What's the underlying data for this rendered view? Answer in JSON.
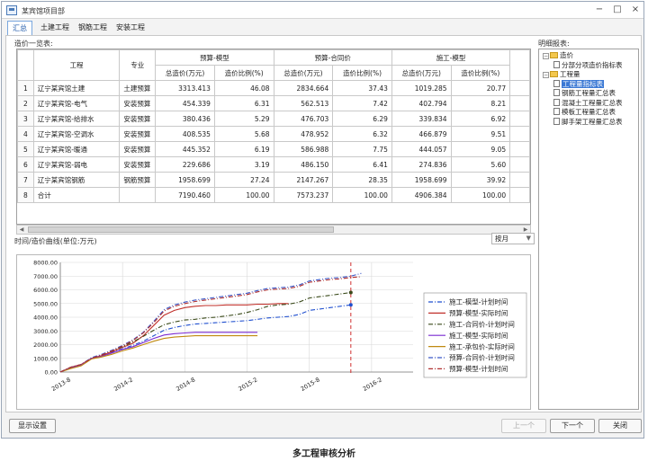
{
  "window": {
    "title": "某宾馆项目部"
  },
  "tabs": [
    {
      "label": "汇总",
      "active": true
    },
    {
      "label": "土建工程",
      "active": false
    },
    {
      "label": "钢筋工程",
      "active": false
    },
    {
      "label": "安装工程",
      "active": false
    }
  ],
  "price_list": {
    "label": "造价一览表:",
    "columns": {
      "project": "工程",
      "discipline": "专业",
      "groups": [
        "预算-模型",
        "预算-合同价",
        "施工-模型"
      ],
      "total": "总造价(万元)",
      "ratio": "造价比例(%)"
    },
    "rows": [
      {
        "no": "1",
        "name": "辽宁某宾馆土建",
        "type": "土建预算",
        "v": [
          "3313.413",
          "46.08",
          "2834.664",
          "37.43",
          "1019.285",
          "20.77"
        ]
      },
      {
        "no": "2",
        "name": "辽宁某宾馆-电气",
        "type": "安装预算",
        "v": [
          "454.339",
          "6.31",
          "562.513",
          "7.42",
          "402.794",
          "8.21"
        ]
      },
      {
        "no": "3",
        "name": "辽宁某宾馆-给排水",
        "type": "安装预算",
        "v": [
          "380.436",
          "5.29",
          "476.703",
          "6.29",
          "339.834",
          "6.92"
        ]
      },
      {
        "no": "4",
        "name": "辽宁某宾馆-空调水",
        "type": "安装预算",
        "v": [
          "408.535",
          "5.68",
          "478.952",
          "6.32",
          "466.879",
          "9.51"
        ]
      },
      {
        "no": "5",
        "name": "辽宁某宾馆-暖通",
        "type": "安装预算",
        "v": [
          "445.352",
          "6.19",
          "586.988",
          "7.75",
          "444.057",
          "9.05"
        ]
      },
      {
        "no": "6",
        "name": "辽宁某宾馆-弱电",
        "type": "安装预算",
        "v": [
          "229.686",
          "3.19",
          "486.150",
          "6.41",
          "274.836",
          "5.60"
        ]
      },
      {
        "no": "7",
        "name": "辽宁某宾馆钢筋",
        "type": "钢筋预算",
        "v": [
          "1958.699",
          "27.24",
          "2147.267",
          "28.35",
          "1958.699",
          "39.92"
        ]
      },
      {
        "no": "8",
        "name": "合计",
        "type": "",
        "v": [
          "7190.460",
          "100.00",
          "7573.237",
          "100.00",
          "4906.384",
          "100.00"
        ]
      }
    ]
  },
  "tree": {
    "label": "明细报表:",
    "nodes": [
      {
        "label": "造价",
        "kind": "folder",
        "level": 0,
        "expand": "−"
      },
      {
        "label": "分部分项造价指标表",
        "kind": "doc",
        "level": 1
      },
      {
        "label": "工程量",
        "kind": "folder",
        "level": 0,
        "expand": "−"
      },
      {
        "label": "工程量指标表",
        "kind": "doc",
        "level": 1,
        "selected": true
      },
      {
        "label": "钢筋工程量汇总表",
        "kind": "doc",
        "level": 1
      },
      {
        "label": "混凝土工程量汇总表",
        "kind": "doc",
        "level": 1
      },
      {
        "label": "模板工程量汇总表",
        "kind": "doc",
        "level": 1
      },
      {
        "label": "脚手架工程量汇总表",
        "kind": "doc",
        "level": 1
      }
    ]
  },
  "curve": {
    "label": "时间/造价曲线(单位:万元)",
    "period_select": "按月"
  },
  "chart_data": {
    "type": "line",
    "title": "时间/造价曲线(单位:万元)",
    "ylim": [
      0,
      8000
    ],
    "yticks": [
      0,
      1000,
      2000,
      3000,
      4000,
      5000,
      6000,
      7000,
      8000
    ],
    "ytick_labels": [
      "0.00",
      "1000.00",
      "2000.00",
      "3000.00",
      "4000.00",
      "5000.00",
      "6000.00",
      "7000.00",
      "8000.00"
    ],
    "xlim": [
      0,
      34
    ],
    "xticks": [
      0,
      6,
      12,
      18,
      24,
      30
    ],
    "xtick_labels": [
      "2013-8",
      "2014-2",
      "2014-8",
      "2015-2",
      "2015-8",
      "2016-2"
    ],
    "marker_x": 28,
    "series": [
      {
        "name": "施工-模型-计划时间",
        "color": "#1f4fcf",
        "dash": "5,2,1,2",
        "x": [
          0,
          1,
          2,
          3,
          4,
          5,
          6,
          7,
          8,
          9,
          10,
          11,
          12,
          13,
          14,
          15,
          16,
          17,
          18,
          19,
          20,
          21,
          22,
          23,
          24,
          25,
          26,
          27,
          28
        ],
        "y": [
          0,
          300,
          500,
          1000,
          1200,
          1450,
          1700,
          1950,
          2250,
          2650,
          3050,
          3250,
          3400,
          3500,
          3550,
          3600,
          3650,
          3700,
          3750,
          3850,
          3950,
          4000,
          4050,
          4200,
          4500,
          4600,
          4700,
          4800,
          4900
        ]
      },
      {
        "name": "预算-模型-实际时间",
        "color": "#c0302a",
        "dash": "",
        "x": [
          0,
          1,
          2,
          3,
          4,
          5,
          6,
          7,
          8,
          9,
          10,
          11,
          12,
          13,
          14,
          15,
          16,
          17,
          18,
          19,
          20,
          21,
          22
        ],
        "y": [
          0,
          350,
          550,
          1000,
          1200,
          1500,
          1800,
          2100,
          2650,
          3400,
          4150,
          4500,
          4700,
          4800,
          4850,
          4850,
          4900,
          4900,
          4900,
          4950,
          4950,
          5000,
          5000
        ]
      },
      {
        "name": "施工-合同价-计划时间",
        "color": "#3a4a1a",
        "dash": "5,2,1,2",
        "x": [
          0,
          1,
          2,
          3,
          4,
          5,
          6,
          7,
          8,
          9,
          10,
          11,
          12,
          13,
          14,
          15,
          16,
          17,
          18,
          19,
          20,
          21,
          22,
          23,
          24,
          25,
          26,
          27,
          28
        ],
        "y": [
          0,
          350,
          550,
          1000,
          1250,
          1550,
          1850,
          2200,
          2600,
          3050,
          3450,
          3650,
          3800,
          3850,
          3950,
          4000,
          4100,
          4200,
          4350,
          4550,
          4800,
          4900,
          4950,
          5100,
          5400,
          5500,
          5600,
          5700,
          5800
        ]
      },
      {
        "name": "施工-模型-实际时间",
        "color": "#7a2ad0",
        "dash": "",
        "x": [
          0,
          1,
          2,
          3,
          4,
          5,
          6,
          7,
          8,
          9,
          10,
          11,
          12,
          13,
          14,
          15,
          16,
          17,
          18,
          19
        ],
        "y": [
          0,
          300,
          500,
          1000,
          1150,
          1400,
          1650,
          1850,
          2150,
          2450,
          2700,
          2800,
          2850,
          2900,
          2900,
          2900,
          2900,
          2900,
          2900,
          2900
        ]
      },
      {
        "name": "施工-承包价-实际时间",
        "color": "#c08a10",
        "dash": "",
        "x": [
          0,
          1,
          2,
          3,
          4,
          5,
          6,
          7,
          8,
          9,
          10,
          11,
          12,
          13,
          14,
          15,
          16,
          17,
          18,
          19
        ],
        "y": [
          0,
          250,
          450,
          950,
          1100,
          1300,
          1550,
          1750,
          2000,
          2250,
          2450,
          2550,
          2600,
          2650,
          2650,
          2650,
          2650,
          2650,
          2650,
          2650
        ]
      },
      {
        "name": "预算-合同价-计划时间",
        "color": "#3a58c8",
        "dash": "5,2,1,2",
        "x": [
          0,
          1,
          2,
          3,
          4,
          5,
          6,
          7,
          8,
          9,
          10,
          11,
          12,
          13,
          14,
          15,
          16,
          17,
          18,
          19,
          20,
          21,
          22,
          23,
          24,
          25,
          26,
          27,
          28,
          29
        ],
        "y": [
          0,
          350,
          550,
          1050,
          1300,
          1600,
          1950,
          2350,
          2900,
          3700,
          4550,
          4900,
          5100,
          5250,
          5350,
          5450,
          5550,
          5650,
          5750,
          5950,
          6100,
          6150,
          6200,
          6350,
          6650,
          6750,
          6850,
          6900,
          7000,
          7200
        ]
      },
      {
        "name": "预算-模型-计划时间",
        "color": "#b03030",
        "dash": "5,2,1,2",
        "x": [
          0,
          1,
          2,
          3,
          4,
          5,
          6,
          7,
          8,
          9,
          10,
          11,
          12,
          13,
          14,
          15,
          16,
          17,
          18,
          19,
          20,
          21,
          22,
          23,
          24,
          25,
          26,
          27,
          28,
          29
        ],
        "y": [
          0,
          350,
          550,
          1000,
          1250,
          1550,
          1900,
          2300,
          2850,
          3600,
          4450,
          4800,
          5000,
          5150,
          5250,
          5350,
          5450,
          5550,
          5650,
          5850,
          6000,
          6050,
          6100,
          6250,
          6550,
          6650,
          6750,
          6800,
          6900,
          6950
        ]
      }
    ]
  },
  "buttons": {
    "display_settings": "显示设置",
    "prev": "上一个",
    "next": "下一个",
    "close": "关闭"
  },
  "caption": "多工程审核分析"
}
